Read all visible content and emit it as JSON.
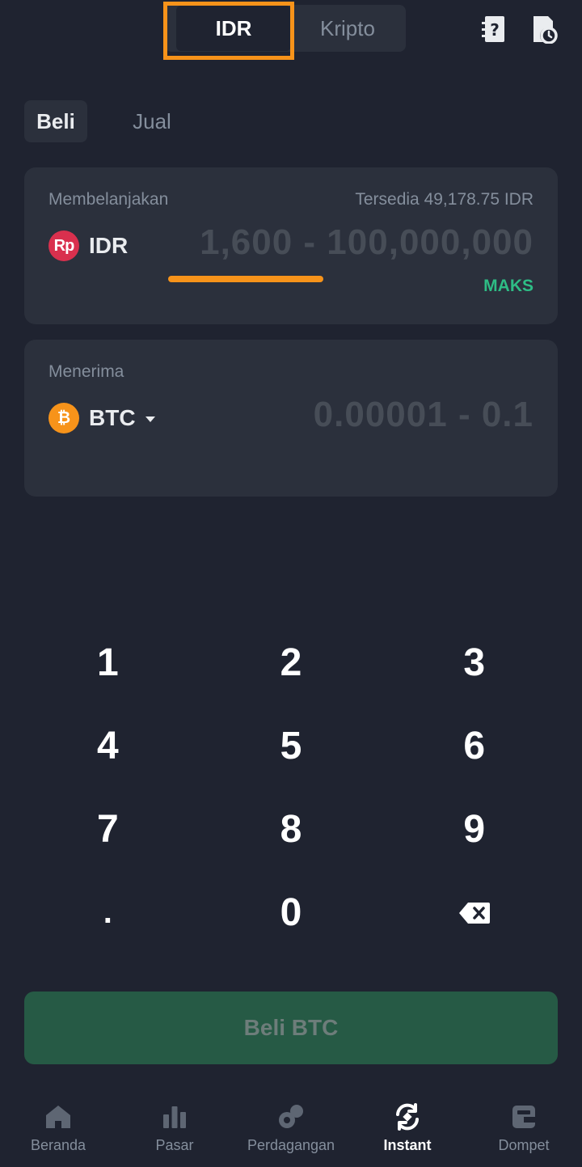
{
  "header": {
    "segments": [
      {
        "label": "IDR",
        "active": true
      },
      {
        "label": "Kripto",
        "active": false
      }
    ],
    "icons": [
      "faq-icon",
      "order-history-icon"
    ]
  },
  "trade_tabs": [
    {
      "label": "Beli",
      "active": true
    },
    {
      "label": "Jual",
      "active": false
    }
  ],
  "spend": {
    "label": "Membelanjakan",
    "available": "Tersedia 49,178.75 IDR",
    "currency": "IDR",
    "currency_logo": "Rp",
    "placeholder": "1,600 - 100,000,000",
    "max_label": "MAKS"
  },
  "receive": {
    "label": "Menerima",
    "currency": "BTC",
    "currency_logo": "₿",
    "placeholder": "0.00001 - 0.1"
  },
  "keypad": {
    "keys": [
      "1",
      "2",
      "3",
      "4",
      "5",
      "6",
      "7",
      "8",
      "9",
      ".",
      "0"
    ],
    "backspace_icon": "backspace-icon"
  },
  "action": {
    "label": "Beli BTC",
    "enabled": false
  },
  "nav": {
    "items": [
      {
        "label": "Beranda",
        "icon": "home-icon",
        "active": false
      },
      {
        "label": "Pasar",
        "icon": "markets-icon",
        "active": false
      },
      {
        "label": "Perdagangan",
        "icon": "trade-icon",
        "active": false
      },
      {
        "label": "Instant",
        "icon": "instant-convert-icon",
        "active": true
      },
      {
        "label": "Dompet",
        "icon": "wallet-icon",
        "active": false
      }
    ]
  },
  "colors": {
    "background": "#1f2330",
    "card": "#2b303c",
    "accent_green": "#2ebd85",
    "highlight_orange": "#f7931a",
    "muted_text": "#848e9c"
  }
}
